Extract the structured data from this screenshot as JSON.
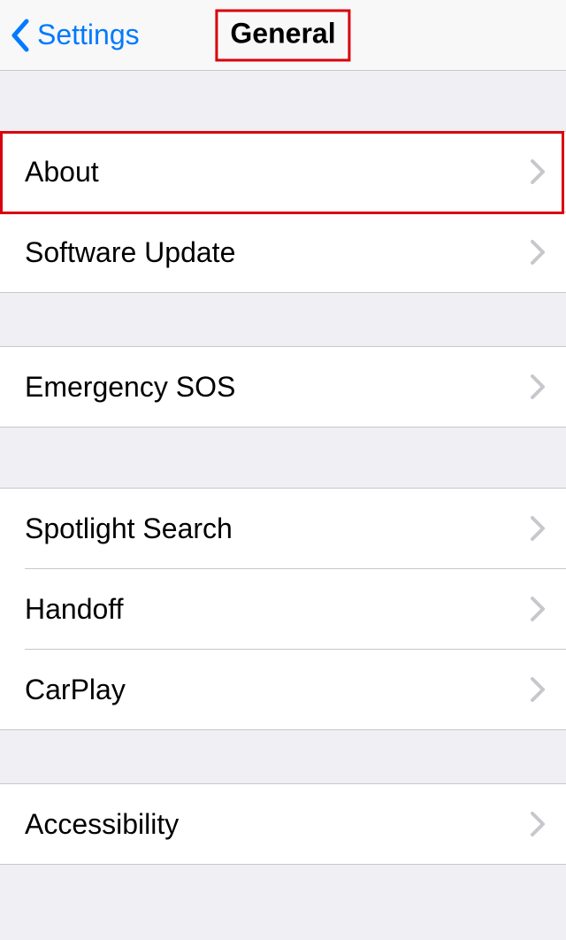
{
  "nav": {
    "back_label": "Settings",
    "title": "General"
  },
  "groups": [
    {
      "items": [
        {
          "label": "About"
        },
        {
          "label": "Software Update"
        }
      ]
    },
    {
      "items": [
        {
          "label": "Emergency SOS"
        }
      ]
    },
    {
      "items": [
        {
          "label": "Spotlight Search"
        },
        {
          "label": "Handoff"
        },
        {
          "label": "CarPlay"
        }
      ]
    },
    {
      "items": [
        {
          "label": "Accessibility"
        }
      ]
    }
  ]
}
